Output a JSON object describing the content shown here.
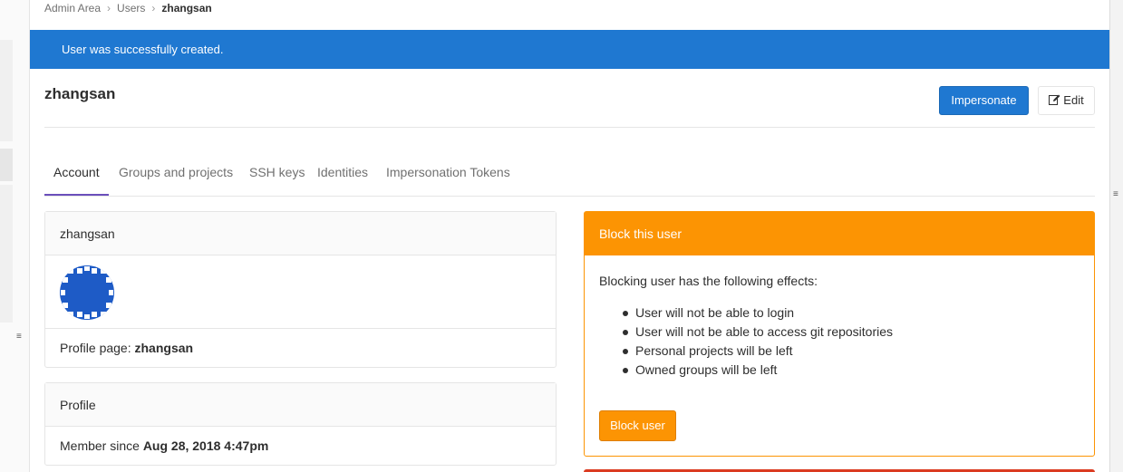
{
  "breadcrumb": {
    "items": [
      "Admin Area",
      "Users",
      "zhangsan"
    ],
    "separator": "›"
  },
  "flash": {
    "message": "User was successfully created.",
    "color": "#1f78d1"
  },
  "page": {
    "title": "zhangsan"
  },
  "actions": {
    "impersonate_label": "Impersonate",
    "edit_label": "Edit",
    "edit_icon": "edit-icon"
  },
  "tabs": [
    {
      "label": "Account",
      "active": true
    },
    {
      "label": "Groups and projects",
      "active": false
    },
    {
      "label": "SSH keys",
      "active": false
    },
    {
      "label": "Identities",
      "active": false
    },
    {
      "label": "Impersonation Tokens",
      "active": false
    }
  ],
  "user_card": {
    "header": "zhangsan",
    "avatar_icon": "identicon-avatar",
    "profile_label": "Profile page: ",
    "profile_value": "zhangsan"
  },
  "profile_card": {
    "header": "Profile",
    "member_label": "Member since ",
    "member_value": "Aug 28, 2018 4:47pm"
  },
  "block_card": {
    "header": "Block this user",
    "intro": "Blocking user has the following effects:",
    "effects": [
      "User will not be able to login",
      "User will not be able to access git repositories",
      "Personal projects will be left",
      "Owned groups will be left"
    ],
    "button_label": "Block user",
    "color": "#fc9403"
  },
  "colors": {
    "primary": "#1f78d1",
    "warning": "#fc9403",
    "danger": "#db3b21",
    "tab_active_underline": "#6b4fbb"
  }
}
